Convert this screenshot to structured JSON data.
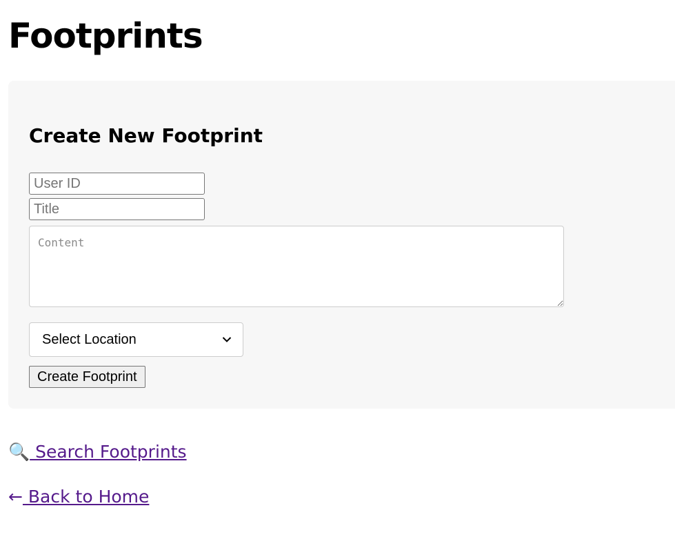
{
  "page": {
    "title": "Footprints"
  },
  "form": {
    "heading": "Create New Footprint",
    "user_id_placeholder": "User ID",
    "title_placeholder": "Title",
    "content_placeholder": "Content",
    "location_selected": "Select Location",
    "submit_label": "Create Footprint"
  },
  "links": {
    "search": {
      "icon": "🔍",
      "label": " Search Footprints"
    },
    "home": {
      "icon": "←",
      "label": " Back to Home"
    }
  },
  "colors": {
    "link": "#551a8b",
    "card_background": "#f7f7f7"
  }
}
